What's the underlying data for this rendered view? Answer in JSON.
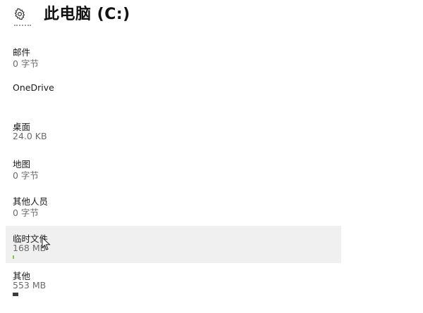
{
  "header": {
    "title": "此电脑 (C:)",
    "icon": "gear-icon"
  },
  "items": [
    {
      "name": "邮件",
      "size": "0 字节",
      "usage_fraction": 0
    },
    {
      "name": "OneDrive",
      "size": "",
      "usage_fraction": 0
    },
    {
      "name": "桌面",
      "size": "24.0 KB",
      "usage_fraction": 0
    },
    {
      "name": "地图",
      "size": "0 字节",
      "usage_fraction": 0
    },
    {
      "name": "其他人员",
      "size": "0 字节",
      "usage_fraction": 0
    },
    {
      "name": "临时文件",
      "size": "168 MB",
      "usage_fraction": 0.004,
      "bar_color": "#8cc63f",
      "hovered": true
    },
    {
      "name": "其他",
      "size": "553 MB",
      "usage_fraction": 0.018,
      "bar_color": "#3a3a3a"
    }
  ],
  "colors": {
    "hover_background": "#f0f0f0",
    "secondary_text": "#6b6b6b",
    "temp_bar": "#8cc63f",
    "other_bar": "#3a3a3a"
  }
}
